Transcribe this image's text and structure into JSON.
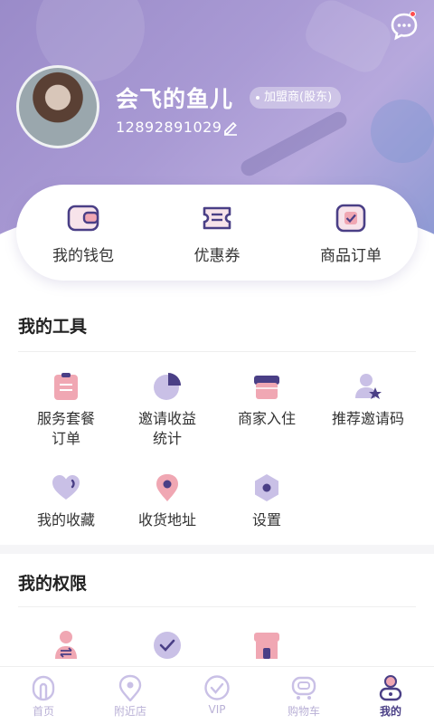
{
  "header": {
    "username": "会飞的鱼儿",
    "badge": "加盟商(股东)",
    "phone": "12892891029"
  },
  "quick_actions": [
    {
      "label": "我的钱包",
      "icon": "wallet-icon"
    },
    {
      "label": "优惠券",
      "icon": "coupon-icon"
    },
    {
      "label": "商品订单",
      "icon": "order-icon"
    }
  ],
  "tools": {
    "title": "我的工具",
    "items": [
      {
        "label": "服务套餐\n订单",
        "icon": "clipboard-icon"
      },
      {
        "label": "邀请收益\n统计",
        "icon": "pie-chart-icon"
      },
      {
        "label": "商家入住",
        "icon": "shop-icon"
      },
      {
        "label": "推荐邀请码",
        "icon": "user-star-icon"
      },
      {
        "label": "我的收藏",
        "icon": "heart-icon"
      },
      {
        "label": "收货地址",
        "icon": "location-pin-icon"
      },
      {
        "label": "设置",
        "icon": "settings-hex-icon"
      }
    ]
  },
  "permissions": {
    "title": "我的权限",
    "items": [
      {
        "icon": "user-exchange-icon"
      },
      {
        "icon": "check-circle-icon"
      },
      {
        "icon": "store-icon"
      }
    ]
  },
  "tabbar": [
    {
      "label": "首页",
      "icon": "home-icon"
    },
    {
      "label": "附近店",
      "icon": "nearby-pin-icon"
    },
    {
      "label": "VIP",
      "icon": "vip-icon"
    },
    {
      "label": "购物车",
      "icon": "cart-icon"
    },
    {
      "label": "我的",
      "icon": "profile-icon",
      "active": true
    }
  ],
  "colors": {
    "brand": "#4a3f86",
    "accent_pink": "#f0a7b3",
    "accent_lavender": "#c9c0e6"
  }
}
